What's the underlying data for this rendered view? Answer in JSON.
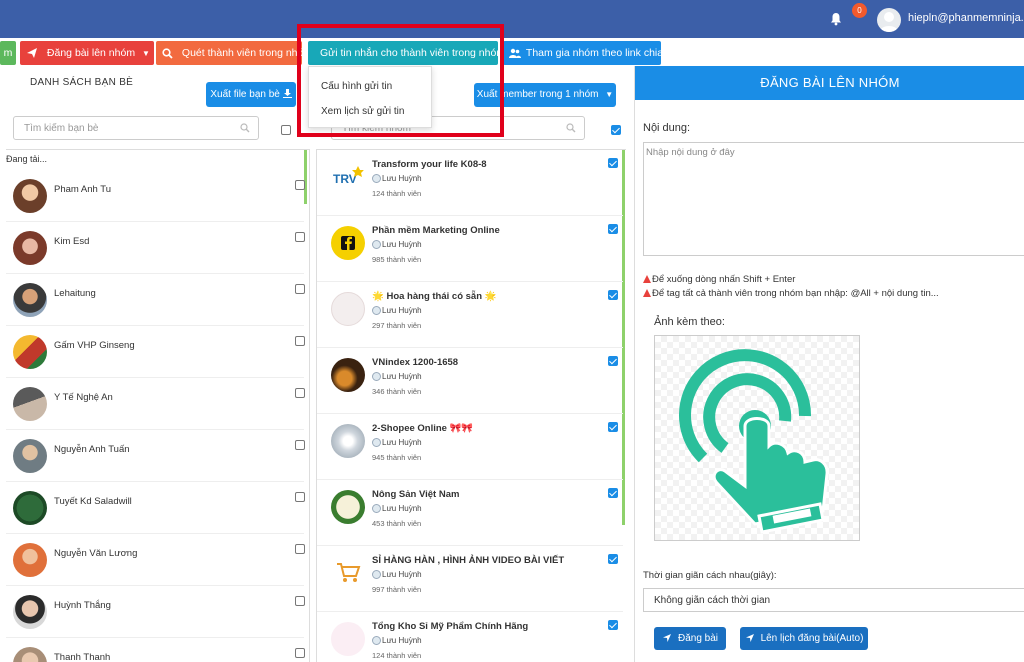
{
  "header": {
    "notification_count": "0",
    "user_email": "hiepln@phanmemninja.com",
    "icons": [
      "bell-icon",
      "user-avatar"
    ],
    "bg_color": "#3c5fa8"
  },
  "tabs": [
    {
      "label": "m",
      "icon": "none",
      "color": "#5cb85c"
    },
    {
      "label": "Đăng bài lên nhóm",
      "icon": "paper-plane-icon",
      "color": "#e8413c"
    },
    {
      "label": "Quét thành viên trong nhóm",
      "icon": "search-icon",
      "color": "#f26a3f"
    },
    {
      "label": "Gửi tin nhắn cho thành viên trong nhóm",
      "icon": "chevron-down-icon",
      "color": "#18a8b8"
    },
    {
      "label": "Tham gia nhóm theo link chia sẻ",
      "icon": "users-icon",
      "color": "#1a8de6"
    }
  ],
  "dropdown": {
    "items": [
      "Cấu hình gửi tin",
      "Xem lịch sử gửi tin"
    ]
  },
  "friends": {
    "title": "DANH SÁCH BẠN BÈ",
    "export_label": "Xuất file bạn bè",
    "search_placeholder": "Tìm kiếm bạn bè",
    "loading_text": "Đang tải...",
    "items": [
      {
        "name": "Pham Anh Tu",
        "checked": false
      },
      {
        "name": "Kim Esd",
        "checked": false
      },
      {
        "name": "Lehaitung",
        "checked": false
      },
      {
        "name": "Gấm VHP Ginseng",
        "checked": false
      },
      {
        "name": "Y Tế Nghệ An",
        "checked": false
      },
      {
        "name": "Nguyễn Anh Tuấn",
        "checked": false
      },
      {
        "name": "Tuyết Kd Saladwill",
        "checked": false
      },
      {
        "name": "Nguyễn Văn Lương",
        "checked": false
      },
      {
        "name": "Huỳnh Thắng",
        "checked": false
      },
      {
        "name": "Thanh Thanh",
        "checked": false
      }
    ]
  },
  "groups": {
    "export_label": "Xuất member trong 1 nhóm",
    "search_placeholder": "Tìm kiếm nhóm",
    "items": [
      {
        "name": "Transform your life K08-8",
        "owner": "Lưu Huỳnh",
        "members": "124 thành viên",
        "checked": true
      },
      {
        "name": "Phần mềm Marketing Online",
        "owner": "Lưu Huỳnh",
        "members": "985 thành viên",
        "checked": true
      },
      {
        "name": "🌟 Hoa hàng thái có sẵn 🌟",
        "owner": "Lưu Huỳnh",
        "members": "297 thành viên",
        "checked": true
      },
      {
        "name": "VNindex 1200-1658",
        "owner": "Lưu Huỳnh",
        "members": "346 thành viên",
        "checked": true
      },
      {
        "name": "2-Shopee Online 🎀🎀",
        "owner": "Lưu Huỳnh",
        "members": "945 thành viên",
        "checked": true
      },
      {
        "name": "Nông Sản Việt Nam",
        "owner": "Lưu Huỳnh",
        "members": "453 thành viên",
        "checked": true
      },
      {
        "name": "SỈ HÀNG HÀN , HÌNH ẢNH VIDEO BÀI VIẾT",
        "owner": "Lưu Huỳnh",
        "members": "997 thành viên",
        "checked": true
      },
      {
        "name": "Tổng Kho Sỉ Mỹ Phẩm Chính Hãng",
        "owner": "Lưu Huỳnh",
        "members": "124 thành viên",
        "checked": true
      }
    ]
  },
  "post_panel": {
    "title": "ĐĂNG BÀI LÊN NHÓM",
    "content_label": "Nội dung:",
    "content_placeholder": "Nhập nội dung ở đây",
    "hint_newline": "Để xuống dòng nhấn Shift + Enter",
    "hint_tag": "Để tag tất cả thành viên trong nhóm bạn nhập: @All + nội dung tin...",
    "attach_label": "Ảnh kèm theo:",
    "interval_label": "Thời gian giãn cách nhau(giây):",
    "interval_value": "Không giãn cách thời gian",
    "post_button": "Đăng bài",
    "schedule_button": "Lên lịch đăng bài(Auto)",
    "accent_color": "#1a8de6",
    "attach_icon": "tap-finger-icon",
    "attach_icon_color": "#2bbf9b"
  }
}
